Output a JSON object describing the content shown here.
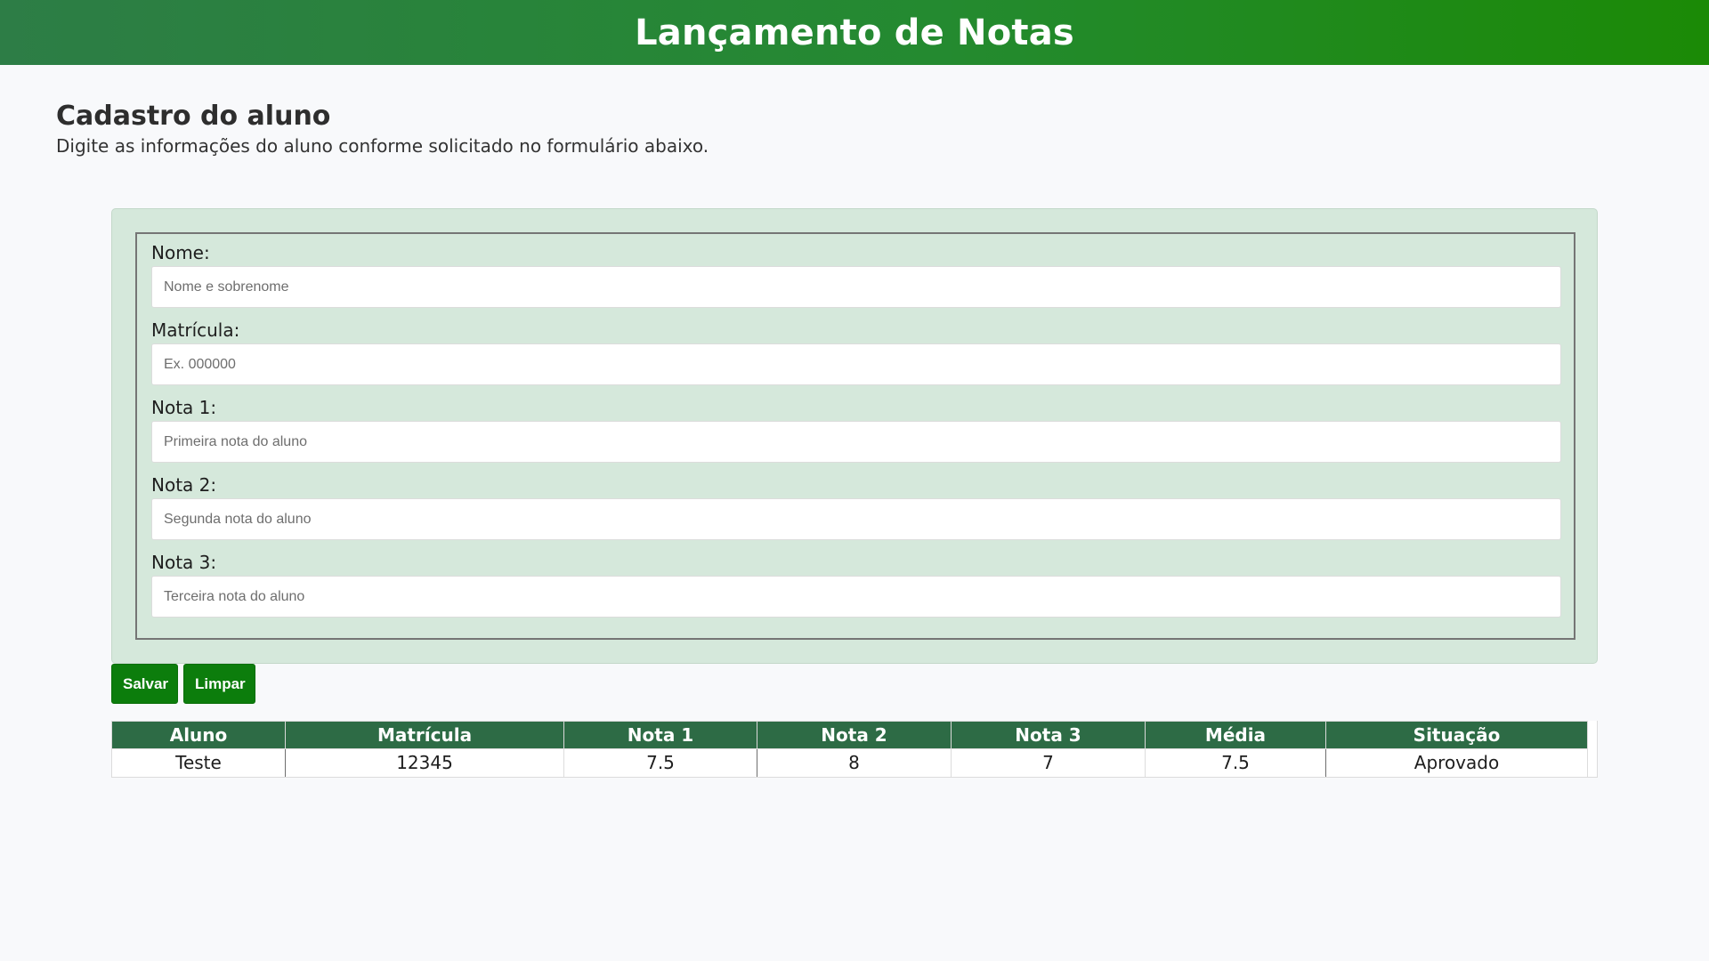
{
  "header": {
    "title": "Lançamento de Notas"
  },
  "intro": {
    "title": "Cadastro do aluno",
    "description": "Digite as informações do aluno conforme solicitado no formulário abaixo."
  },
  "form": {
    "fields": [
      {
        "label": "Nome:",
        "placeholder": "Nome e sobrenome",
        "value": ""
      },
      {
        "label": "Matrícula:",
        "placeholder": "Ex. 000000",
        "value": ""
      },
      {
        "label": "Nota 1:",
        "placeholder": "Primeira nota do aluno",
        "value": ""
      },
      {
        "label": "Nota 2:",
        "placeholder": "Segunda nota do aluno",
        "value": ""
      },
      {
        "label": "Nota 3:",
        "placeholder": "Terceira nota do aluno",
        "value": ""
      }
    ]
  },
  "buttons": {
    "save_label": "Salvar",
    "clear_label": "Limpar"
  },
  "colors": {
    "accent": "#0c7d0c",
    "table_header": "#2d6b45",
    "panel": "#d5e8db"
  },
  "table": {
    "headers": [
      "Aluno",
      "Matrícula",
      "Nota 1",
      "Nota 2",
      "Nota 3",
      "Média",
      "Situação"
    ],
    "rows": [
      [
        "Teste",
        "12345",
        "7.5",
        "8",
        "7",
        "7.5",
        "Aprovado"
      ]
    ]
  }
}
